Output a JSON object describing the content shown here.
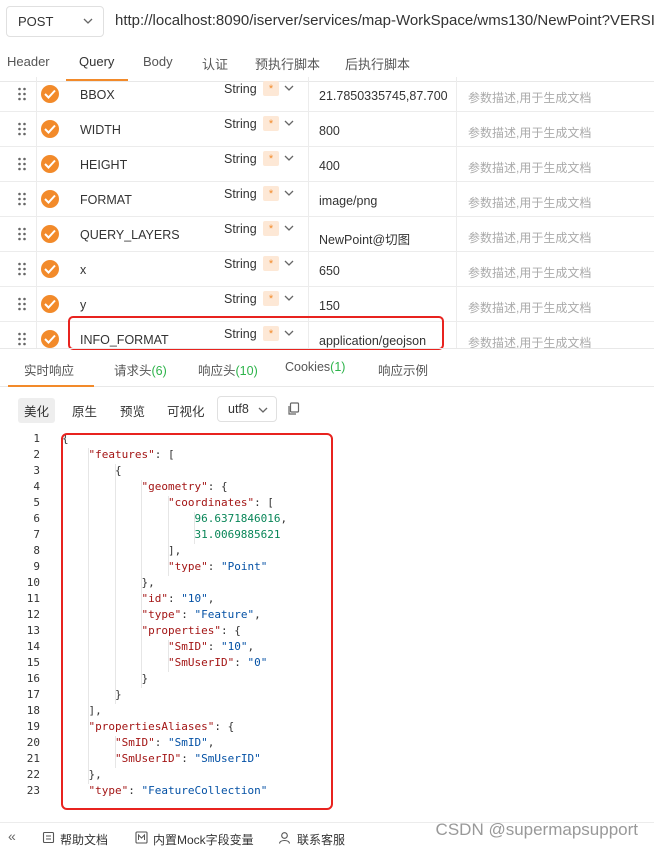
{
  "request": {
    "method": "POST",
    "url": "http://localhost:8090/iserver/services/map-WorkSpace/wms130/NewPoint?VERSIO"
  },
  "tabs": [
    "Header",
    "Query",
    "Body",
    "认证",
    "预执行脚本",
    "后执行脚本"
  ],
  "active_tab": "Query",
  "params": [
    {
      "name": "BBOX",
      "type": "String",
      "required": "*",
      "value": "21.7850335745,87.700",
      "desc": "参数描述,用于生成文档"
    },
    {
      "name": "WIDTH",
      "type": "String",
      "required": "*",
      "value": "800",
      "desc": "参数描述,用于生成文档"
    },
    {
      "name": "HEIGHT",
      "type": "String",
      "required": "*",
      "value": "400",
      "desc": "参数描述,用于生成文档"
    },
    {
      "name": "FORMAT",
      "type": "String",
      "required": "*",
      "value": "image/png",
      "desc": "参数描述,用于生成文档"
    },
    {
      "name": "QUERY_LAYERS",
      "type": "String",
      "required": "*",
      "value": "NewPoint@切图",
      "desc": "参数描述,用于生成文档"
    },
    {
      "name": "x",
      "type": "String",
      "required": "*",
      "value": "650",
      "desc": "参数描述,用于生成文档"
    },
    {
      "name": "y",
      "type": "String",
      "required": "*",
      "value": "150",
      "desc": "参数描述,用于生成文档"
    },
    {
      "name": "INFO_FORMAT",
      "type": "String",
      "required": "*",
      "value": "application/geojson",
      "desc": "参数描述,用于生成文档"
    }
  ],
  "response_tabs": [
    {
      "label": "实时响应",
      "count": ""
    },
    {
      "label": "请求头",
      "count": "(6)"
    },
    {
      "label": "响应头",
      "count": "(10)"
    },
    {
      "label": "Cookies",
      "count": "(1)"
    },
    {
      "label": "响应示例",
      "count": ""
    }
  ],
  "toolbar": {
    "beautify": "美化",
    "raw": "原生",
    "preview": "预览",
    "visualize": "可视化",
    "encoding": "utf8"
  },
  "code_lines": [
    "{",
    "    \"features\": [",
    "        {",
    "            \"geometry\": {",
    "                \"coordinates\": [",
    "                    96.6371846016,",
    "                    31.0069885621",
    "                ],",
    "                \"type\": \"Point\"",
    "            },",
    "            \"id\": \"10\",",
    "            \"type\": \"Feature\",",
    "            \"properties\": {",
    "                \"SmID\": \"10\",",
    "                \"SmUserID\": \"0\"",
    "            }",
    "        }",
    "    ],",
    "    \"propertiesAliases\": {",
    "        \"SmID\": \"SmID\",",
    "        \"SmUserID\": \"SmUserID\"",
    "    },",
    "    \"type\": \"FeatureCollection\""
  ],
  "footer": {
    "collapse": "«",
    "help": "帮助文档",
    "mock": "内置Mock字段变量",
    "support": "联系客服"
  },
  "watermark": "CSDN @supermapsupport",
  "colors": {
    "accent": "#f28a2a",
    "highlight": "#e8231f",
    "count": "#2db34a"
  }
}
